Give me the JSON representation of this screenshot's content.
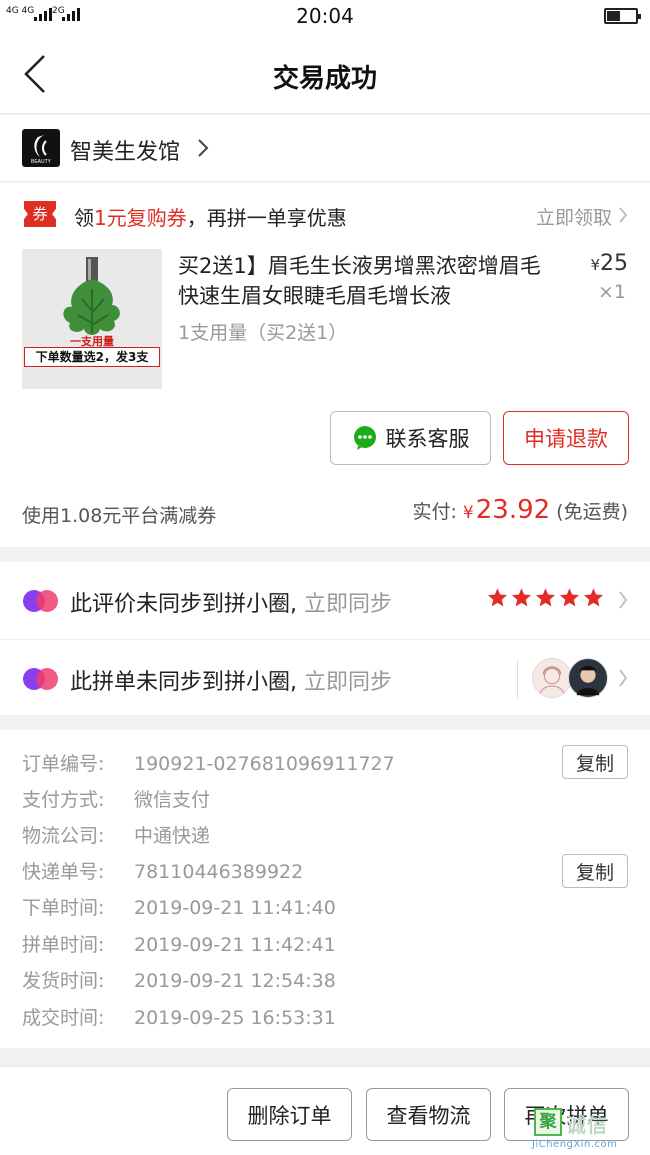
{
  "status_bar": {
    "carrier1": "4G 4G",
    "carrier2": "2G",
    "time": "20:04",
    "battery_level": 0.45
  },
  "navbar": {
    "title": "交易成功"
  },
  "shop": {
    "name": "智美生发馆",
    "logo_text": "BEAUTY"
  },
  "coupon": {
    "badge": "券",
    "text_prefix": "领",
    "text_highlight": "1元复购券",
    "text_suffix": "，再拼一单享优惠",
    "action": "立即领取"
  },
  "product": {
    "image_label1": "一支用量",
    "image_label2": "下单数量选2，发3支",
    "title": "买2送1】眉毛生长液男增黑浓密增眉毛快速生眉女眼睫毛眉毛增长液",
    "spec": "1支用量（买2送1）",
    "price_currency": "¥",
    "price": "25",
    "quantity": "×1"
  },
  "actions": {
    "service_label": "联系客服",
    "refund_label": "申请退款"
  },
  "payment": {
    "discount_text": "使用1.08元平台满减券",
    "paid_label": "实付:",
    "currency": "¥",
    "amount": "23.92",
    "shipping_note": "(免运费)"
  },
  "sync": {
    "review_text": "此评价未同步到拼小圈,",
    "review_link": "立即同步",
    "rating": 5,
    "group_text": "此拼单未同步到拼小圈,",
    "group_link": "立即同步"
  },
  "order_info": {
    "copy_label": "复制",
    "rows": [
      {
        "label": "订单编号:",
        "value": "190921-027681096911727"
      },
      {
        "label": "支付方式:",
        "value": "微信支付"
      },
      {
        "label": "物流公司:",
        "value": "中通快递"
      },
      {
        "label": "快递单号:",
        "value": "78110446389922"
      },
      {
        "label": "下单时间:",
        "value": "2019-09-21 11:41:40"
      },
      {
        "label": "拼单时间:",
        "value": "2019-09-21 11:42:41"
      },
      {
        "label": "发货时间:",
        "value": "2019-09-21 12:54:38"
      },
      {
        "label": "成交时间:",
        "value": "2019-09-25 16:53:31"
      }
    ]
  },
  "bottom_bar": {
    "delete_label": "删除订单",
    "logistics_label": "查看物流",
    "reorder_label": "再次拼单"
  },
  "watermark": {
    "logo": "聚",
    "name": "诚信",
    "url": "JiChengXin.com"
  },
  "colors": {
    "accent": "#e02e24",
    "background": "#f2f2f2"
  }
}
